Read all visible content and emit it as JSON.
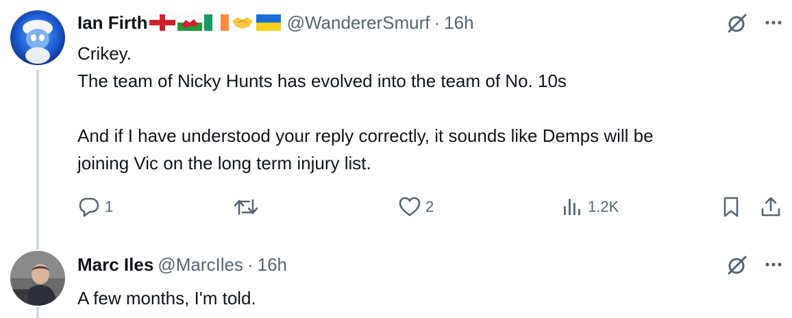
{
  "tweets": [
    {
      "display_name": "Ian Firth",
      "handle": "@WandererSmurf",
      "separator": "·",
      "time": "16h",
      "flags": [
        "england-flag",
        "wales-flag",
        "ireland-flag",
        "handshake-emoji",
        "ukraine-flag"
      ],
      "lines": [
        "Crikey.",
        "The team of Nicky Hunts has evolved into the team of No. 10s",
        "",
        "And if I have understood your reply correctly, it sounds like Demps will be",
        "joining Vic on the long term injury list."
      ],
      "actions": {
        "replies": "1",
        "retweets": "",
        "likes": "2",
        "views": "1.2K"
      }
    },
    {
      "display_name": "Marc Iles",
      "handle": "@MarcIles",
      "separator": "·",
      "time": "16h",
      "lines": [
        "A few months, I'm told."
      ]
    }
  ],
  "icons": {
    "grok": "grok-icon",
    "more": "more-icon",
    "reply": "reply-icon",
    "retweet": "retweet-icon",
    "like": "heart-icon",
    "views": "views-icon",
    "bookmark": "bookmark-icon",
    "share": "share-icon"
  },
  "colors": {
    "text": "#0f1419",
    "secondary": "#536471",
    "thread_line": "#cfd9de"
  }
}
